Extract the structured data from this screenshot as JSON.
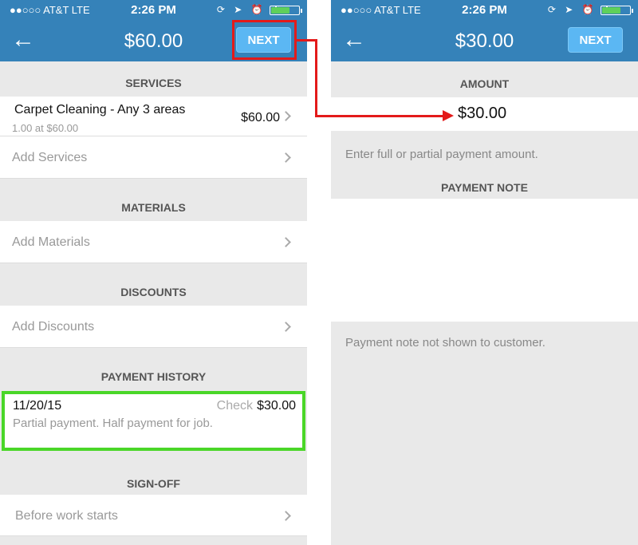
{
  "status": {
    "carrier": "●●○○○ AT&T  LTE",
    "time": "2:26 PM",
    "icons": "⟳ ➤ ⏰ ✱",
    "battery_level": 0.65
  },
  "left": {
    "back_icon": "←",
    "title": "$60.00",
    "next_label": "NEXT",
    "sections": {
      "services": "SERVICES",
      "materials": "MATERIALS",
      "discounts": "DISCOUNTS",
      "payment_history": "PAYMENT HISTORY",
      "sign_off": "SIGN-OFF"
    },
    "service_item": {
      "title": "Carpet Cleaning - Any 3 areas",
      "subtitle": "1.00 at $60.00",
      "price": "$60.00"
    },
    "add_services": "Add Services",
    "add_materials": "Add Materials",
    "add_discounts": "Add Discounts",
    "payment": {
      "date": "11/20/15",
      "method": "Check",
      "amount": "$30.00",
      "note": "Partial payment. Half payment for job."
    },
    "before_work": "Before work starts"
  },
  "right": {
    "back_icon": "←",
    "title": "$30.00",
    "next_label": "NEXT",
    "amount_header": "AMOUNT",
    "amount_value": "$30.00",
    "amount_hint": "Enter full or partial payment amount.",
    "note_header": "PAYMENT NOTE",
    "note_hint": "Payment note not shown to customer."
  },
  "colors": {
    "brand": "#3582b9",
    "next_button": "#5bb7f3",
    "highlight_red": "#e31a1a",
    "highlight_green": "#4ad628"
  }
}
